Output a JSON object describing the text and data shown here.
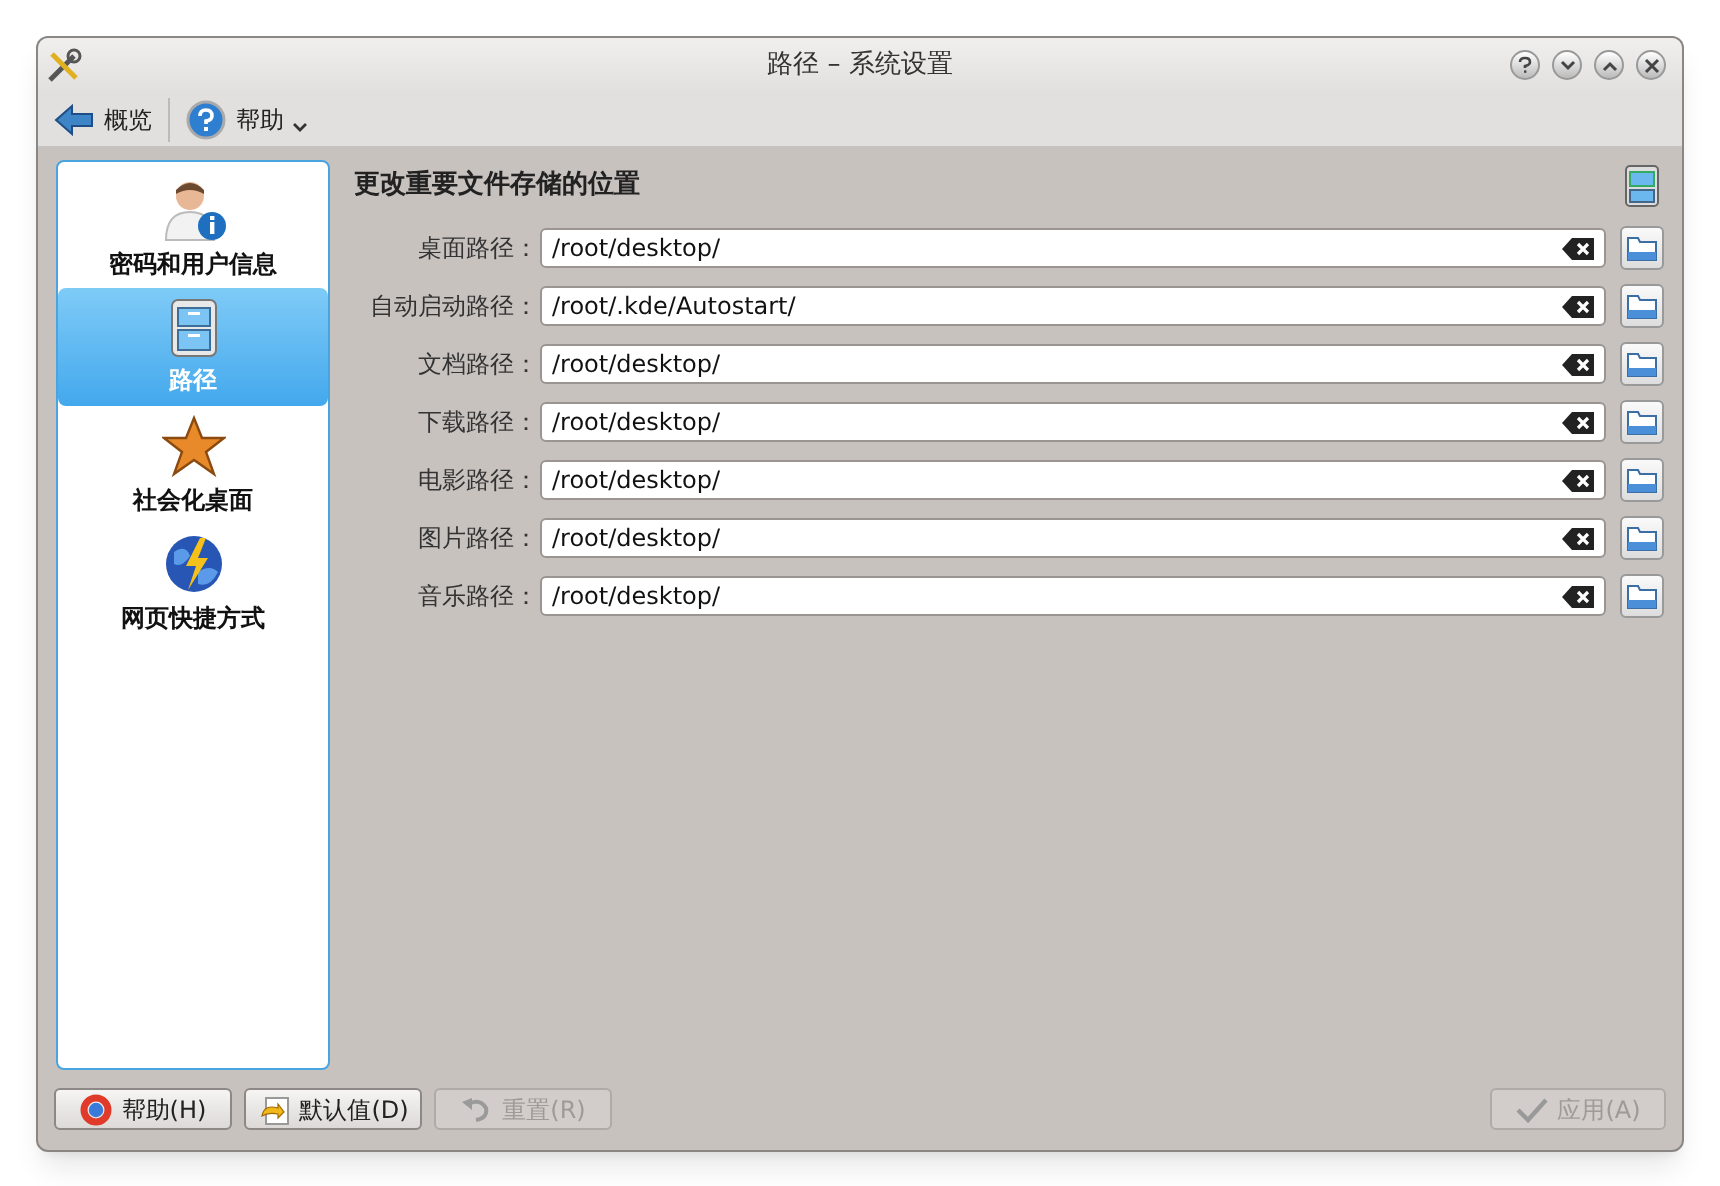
{
  "window": {
    "title": "路径 – 系统设置"
  },
  "toolbar": [
    {
      "kind": "back",
      "label": "概览"
    },
    {
      "kind": "help",
      "label": "帮助"
    }
  ],
  "sidebar": {
    "items": [
      {
        "kind": "user",
        "label": "密码和用户信息",
        "selected": false
      },
      {
        "kind": "cabinet",
        "label": "路径",
        "selected": true
      },
      {
        "kind": "star",
        "label": "社会化桌面",
        "selected": false
      },
      {
        "kind": "globe",
        "label": "网页快捷方式",
        "selected": false
      }
    ]
  },
  "heading": "更改重要文件存储的位置",
  "paths": [
    {
      "label": "桌面路径：",
      "value": "/root/desktop/"
    },
    {
      "label": "自动启动路径：",
      "value": "/root/.kde/Autostart/"
    },
    {
      "label": "文档路径：",
      "value": "/root/desktop/"
    },
    {
      "label": "下载路径：",
      "value": "/root/desktop/"
    },
    {
      "label": "电影路径：",
      "value": "/root/desktop/"
    },
    {
      "label": "图片路径：",
      "value": "/root/desktop/"
    },
    {
      "label": "音乐路径：",
      "value": "/root/desktop/"
    }
  ],
  "buttons": [
    {
      "kind": "help",
      "label": "帮助(H)",
      "disabled": false
    },
    {
      "kind": "defaults",
      "label": "默认值(D)",
      "disabled": false
    },
    {
      "kind": "reset",
      "label": "重置(R)",
      "disabled": true
    },
    {
      "kind": "apply",
      "label": "应用(A)",
      "disabled": true
    }
  ]
}
